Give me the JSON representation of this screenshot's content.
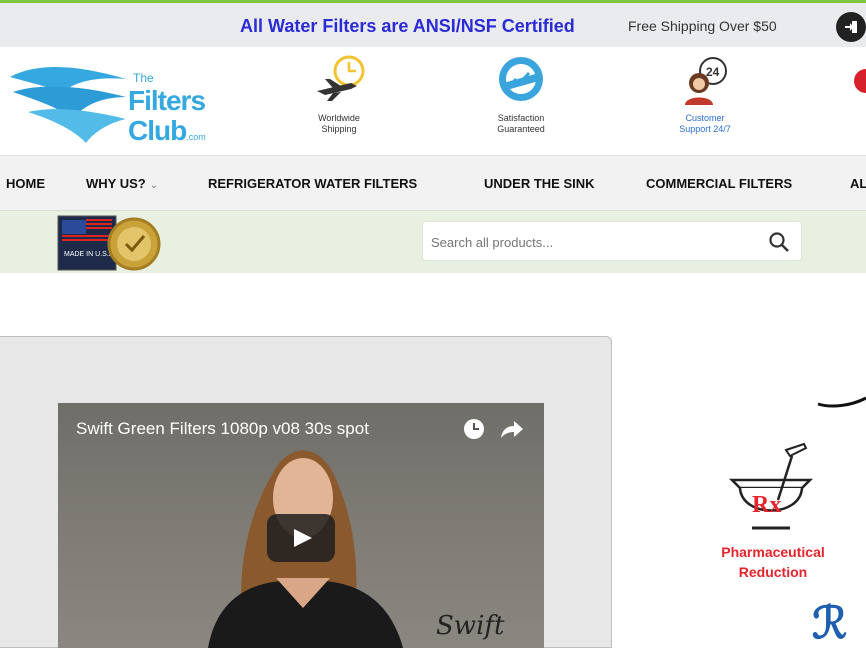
{
  "announcement": {
    "promo": "All Water Filters are ANSI/NSF Certified",
    "shipping": "Free Shipping Over $50"
  },
  "logo": {
    "the": "The",
    "filters": "Filters",
    "club": "Club",
    "tld": ".com"
  },
  "features": [
    {
      "icon": "airplane-clock-icon",
      "line1": "Worldwide",
      "line2": "Shipping"
    },
    {
      "icon": "satisfaction-seal-icon",
      "line1": "Satisfaction",
      "line2": "Guaranteed"
    },
    {
      "icon": "customer-support-icon",
      "line1": "Customer",
      "line2": "Support 24/7"
    }
  ],
  "nav": {
    "items": [
      "HOME",
      "WHY US?",
      "REFRIGERATOR WATER FILTERS",
      "UNDER THE SINK",
      "COMMERCIAL FILTERS",
      "AL"
    ]
  },
  "badge": {
    "text": "MADE IN U.S.A."
  },
  "search": {
    "placeholder": "Search all products..."
  },
  "video": {
    "title": "Swift Green Filters 1080p v08 30s spot",
    "brand": "Swift"
  },
  "rx": {
    "symbol": "Rx",
    "line1": "Pharmaceutical",
    "line2": "Reduction"
  },
  "colors": {
    "accent_green": "#7ec540",
    "promo_blue": "#2b2bd6",
    "logo_blue": "#35a8e0",
    "rx_red": "#e5242b"
  }
}
